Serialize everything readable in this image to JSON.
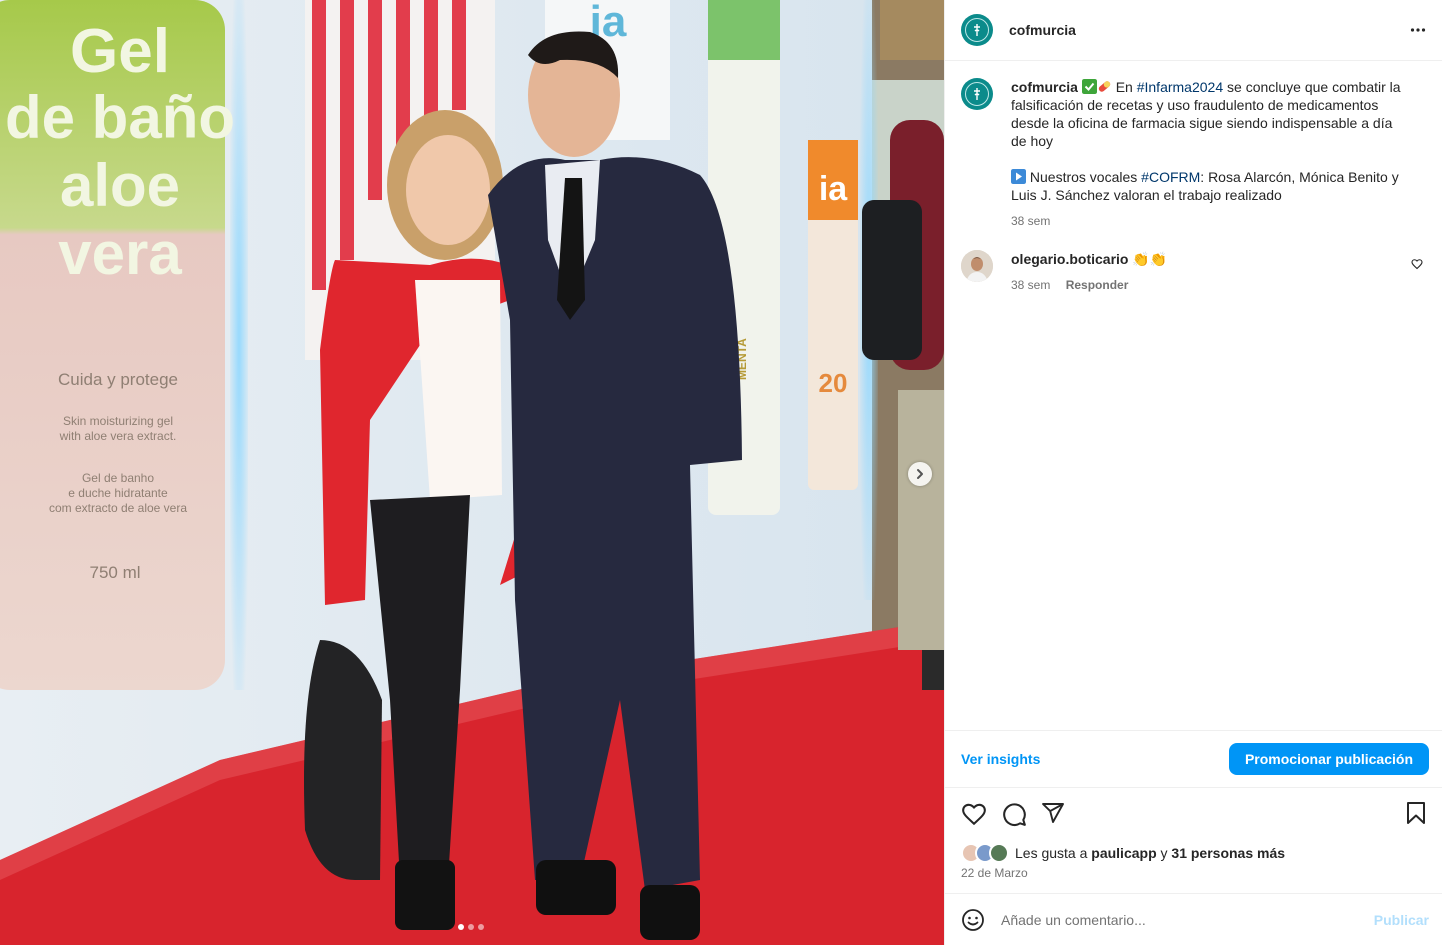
{
  "post": {
    "username": "cofmurcia",
    "more_icon": "more-horizontal-icon",
    "caption": {
      "username": "cofmurcia",
      "part1": "En",
      "hashtag1": "#Infarma2024",
      "part2": "se concluye que combatir la falsificación de recetas y uso fraudulento de medicamentos desde la oficina de farmacia sigue siendo indispensable a día de hoy",
      "part3": "Nuestros vocales",
      "hashtag2": "#COFRM",
      "part4": ": Rosa Alarcón, Mónica Benito y Luis J. Sánchez valoran el trabajo realizado",
      "time": "38 sem"
    },
    "comments": [
      {
        "username": "olegario.boticario",
        "text": "👏👏",
        "time": "38 sem",
        "reply_label": "Responder"
      }
    ],
    "insights_label": "Ver insights",
    "promote_label": "Promocionar publicación",
    "likes": {
      "prefix": "Les gusta a",
      "user": "paulicapp",
      "connector": "y",
      "others": "31 personas más"
    },
    "date": "22 de Marzo",
    "comment_input_placeholder": "Añade un comentario...",
    "publish_label": "Publicar"
  },
  "photo": {
    "carousel_pages": 3,
    "active_page": 1,
    "product_text": {
      "line1": "Gel",
      "line2": "de baño",
      "line3": "aloe",
      "line4": "vera",
      "tagline": "Cuida y protege",
      "desc1": "Skin moisturizing gel",
      "desc2": "with aloe vera extract.",
      "desc3": "Gel de banho",
      "desc4": "e duche hidratante",
      "desc5": "com extracto de aloe vera",
      "volume": "750 ml",
      "brand": "ia",
      "menta": "MENTA",
      "spf": "20"
    }
  },
  "colors": {
    "accent": "#0095f6",
    "hashtag": "#00376b",
    "avatar_bg": "#0b8b8b",
    "muted": "#737373",
    "carpet": "#d8242d"
  }
}
